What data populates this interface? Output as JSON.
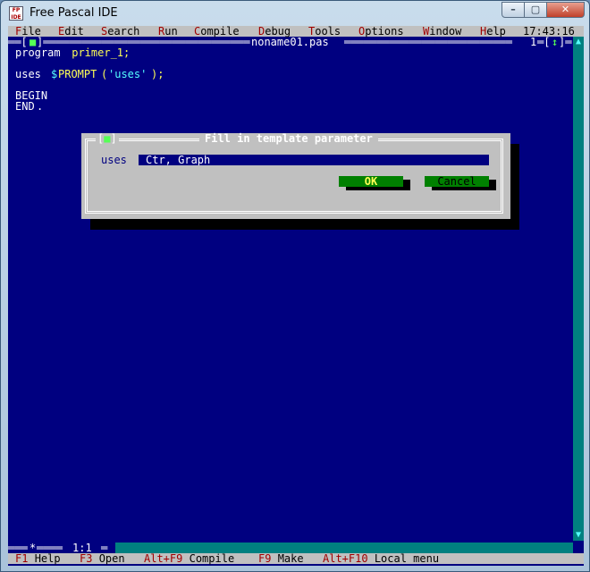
{
  "window": {
    "title": "Free Pascal IDE",
    "controls": {
      "minimize": "–",
      "maximize": "▢",
      "close": "✕"
    }
  },
  "menubar": {
    "items": [
      {
        "hot": "F",
        "rest": "ile"
      },
      {
        "hot": "E",
        "rest": "dit"
      },
      {
        "hot": "S",
        "rest": "earch"
      },
      {
        "hot": "R",
        "rest": "un"
      },
      {
        "hot": "C",
        "rest": "ompile"
      },
      {
        "hot": "D",
        "rest": "ebug"
      },
      {
        "hot": "T",
        "rest": "ools"
      },
      {
        "hot": "O",
        "rest": "ptions"
      },
      {
        "hot": "W",
        "rest": "indow"
      },
      {
        "hot": "H",
        "rest": "elp"
      }
    ],
    "clock": "17:43:16"
  },
  "editor": {
    "filename": "noname01.pas",
    "window_number": "1",
    "close_glyph": "■",
    "zoom_glyph": "↕",
    "lines": [
      {
        "kw": "program",
        "rest": " primer_1;"
      },
      {
        "kw": "uses",
        "sp": " ",
        "dollar": "$",
        "macro": "PROMPT",
        "paren": "(",
        "str": "'uses'",
        "tail": ");"
      },
      {
        "kw": "BEGIN"
      },
      {
        "kw": "END",
        "rest": "."
      }
    ],
    "position": "1:1",
    "modified_mark": "*"
  },
  "dialog": {
    "title": "Fill in template parameter",
    "close_glyph": "■",
    "label": "uses",
    "input_value": "Ctr, Graph",
    "ok_label": "OK",
    "cancel_label": "Cancel"
  },
  "statusbar": {
    "items": [
      {
        "key": "F1",
        "label": "Help"
      },
      {
        "key": "F3",
        "label": "Open"
      },
      {
        "key": "Alt+F9",
        "label": "Compile"
      },
      {
        "key": "F9",
        "label": "Make"
      },
      {
        "key": "Alt+F10",
        "label": "Local menu"
      }
    ]
  },
  "colors": {
    "background": "#000080",
    "menu_bg": "#c0c0c0",
    "hotkey": "#a00000",
    "keyword": "#ffffff",
    "identifier": "#ffff55",
    "string": "#55ffff",
    "button": "#008000"
  }
}
